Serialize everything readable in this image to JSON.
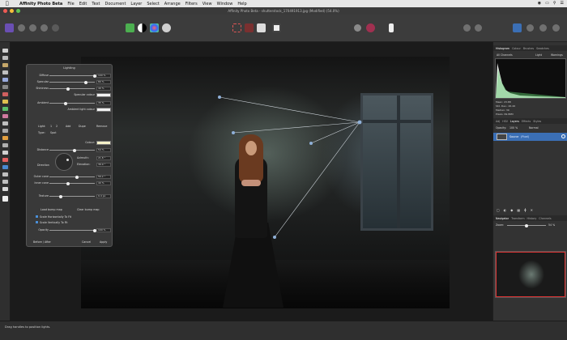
{
  "menubar": {
    "app_name": "Affinity Photo Beta",
    "items": [
      "File",
      "Edit",
      "Text",
      "Document",
      "Layer",
      "Select",
      "Arrange",
      "Filters",
      "View",
      "Window",
      "Help"
    ]
  },
  "titlebar": {
    "title": "Affinity Photo Beta - shutterstock_170491913.jpg (Modified) (54.0%)"
  },
  "lighting": {
    "title": "Lighting",
    "diffuse": {
      "label": "Diffuse",
      "value": "100 %"
    },
    "specular": {
      "label": "Specular",
      "value": "80 %"
    },
    "shininess": {
      "label": "Shininess",
      "value": "40 %"
    },
    "specular_colour": {
      "label": "Specular colour"
    },
    "ambient": {
      "label": "Ambient",
      "value": "35 %"
    },
    "ambient_light_colour": {
      "label": "Ambient light colour"
    },
    "light_tabs": {
      "label": "Light:",
      "one": "1",
      "two": "2",
      "add": "Add",
      "dupe": "Dupe",
      "remove": "Remove"
    },
    "type": {
      "label": "Type:",
      "value": "Spot"
    },
    "colour": {
      "label": "Colour:"
    },
    "distance": {
      "label": "Distance",
      "value": "54 %"
    },
    "direction": {
      "label": "Direction"
    },
    "azimuth": {
      "label": "Azimuth:",
      "value": "21.8 °"
    },
    "elevation": {
      "label": "Elevation:",
      "value": "36.9 °"
    },
    "outer_cone": {
      "label": "Outer cone",
      "value": "56.2 °"
    },
    "inner_cone": {
      "label": "Inner cone",
      "value": "40 %"
    },
    "texture": {
      "label": "Texture",
      "value": "9.4 px"
    },
    "load_bump": "Load bump map",
    "clear_bump": "Clear bump map",
    "scale_h": "Scale Horizontally To Fit",
    "scale_v": "Scale Vertically To Fit",
    "opacity": {
      "label": "Opacity",
      "value": "100 %"
    },
    "before_after": "Before / After",
    "cancel": "Cancel",
    "apply": "Apply"
  },
  "right_panel": {
    "top_tabs": [
      "Histogram",
      "Colour",
      "Brushes",
      "Swatches"
    ],
    "channels": "All Channels",
    "light_btn": "Light",
    "warnings": "Warnings",
    "stats": {
      "mean": "Mean: 23.88",
      "std": "Std. Dev.: 26.46",
      "median": "Median: 39",
      "pixels": "Pixels: 69.86M"
    },
    "mid_tabs": [
      "Adj",
      "HSV",
      "Layers",
      "Effects",
      "Styles"
    ],
    "opacity_label": "Opacity:",
    "opacity_value": "100 %",
    "blend_mode": "Normal",
    "layer_name": "Source",
    "layer_kind": "(Pixel)",
    "nav_tabs": [
      "Navigator",
      "Transform",
      "History",
      "Channels"
    ],
    "zoom_label": "Zoom:",
    "zoom_value": "54 %"
  },
  "statusbar": {
    "text": "Drag handles to position lights."
  },
  "colors": {
    "accent": "#3b6fb5",
    "colour_swatch": "#f4f0c8"
  }
}
